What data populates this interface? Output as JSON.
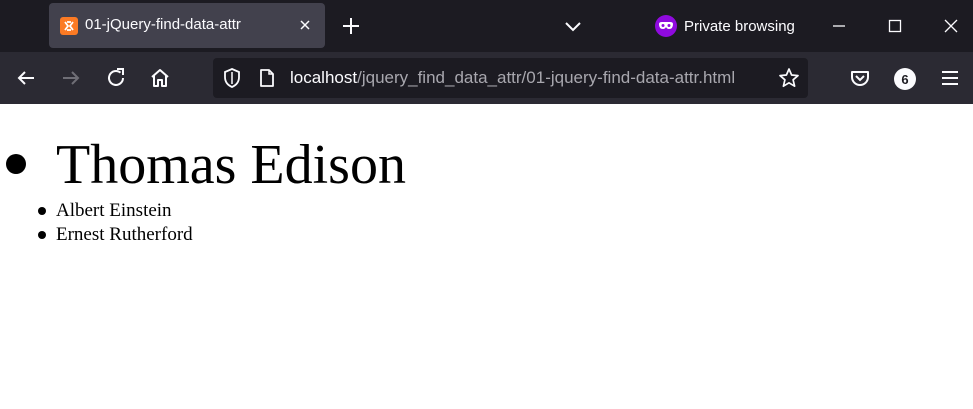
{
  "browser": {
    "tab": {
      "title": "01-jQuery-find-data-attr",
      "favicon": "xampp-icon"
    },
    "private_label": "Private browsing",
    "url": {
      "host": "localhost",
      "path": "/jquery_find_data_attr/01-jquery-find-data-attr.html"
    },
    "extension_badge": "6",
    "colors": {
      "titlebar": "#1c1b22",
      "navbar": "#2b2a33",
      "tab_active": "#42414d",
      "private_accent": "#8f0ade"
    }
  },
  "page": {
    "main_item": "Thomas Edison",
    "sub_items": [
      "Albert Einstein",
      "Ernest Rutherford"
    ]
  }
}
